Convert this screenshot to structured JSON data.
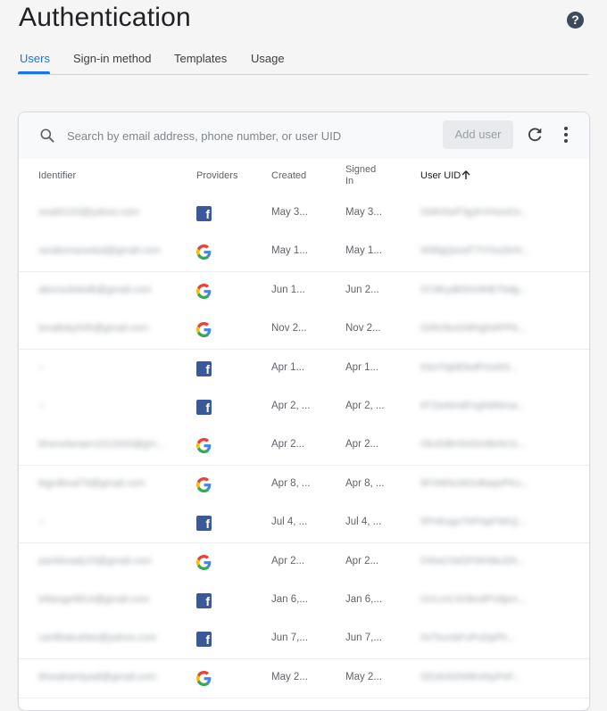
{
  "page": {
    "title": "Authentication",
    "help_icon": "help-circle-icon"
  },
  "tabs": [
    {
      "label": "Users",
      "active": true
    },
    {
      "label": "Sign-in method",
      "active": false
    },
    {
      "label": "Templates",
      "active": false
    },
    {
      "label": "Usage",
      "active": false
    }
  ],
  "toolbar": {
    "search_placeholder": "Search by email address, phone number, or user UID",
    "search_value": "",
    "add_user_label": "Add user",
    "refresh_icon": "refresh-icon",
    "more_icon": "more-vert-icon"
  },
  "table": {
    "columns": {
      "identifier": "Identifier",
      "providers": "Providers",
      "created": "Created",
      "signed_in_line1": "Signed",
      "signed_in_line2": "In",
      "user_uid": "User UID"
    },
    "sort_icon": "arrow-up-icon",
    "rows": [
      {
        "identifier": "ovati0153@yahoo.com",
        "provider": "facebook",
        "created": "May 3...",
        "signed_in": "May 3...",
        "uid": "GMHSeP3g3rVHsmDv..."
      },
      {
        "identifier": "raraitumaraskal@gmail.com",
        "provider": "google",
        "created": "May 1...",
        "signed_in": "May 1...",
        "uid": "W9tlgQevdT7tYhoZkHt..."
      },
      {
        "identifier": "abonsololedb@gmail.com",
        "provider": "google",
        "created": "Jun 1...",
        "signed_in": "Jun 2...",
        "uid": "O7dKydk5Hv9hB7Ndg..."
      },
      {
        "identifier": "lonaltoky545@gmail.com",
        "provider": "google",
        "created": "Nov 2...",
        "signed_in": "Nov 2...",
        "uid": "G0hOkoGMHgNAPPb..."
      },
      {
        "identifier": "--",
        "provider": "facebook",
        "created": "Apr 1...",
        "signed_in": "Apr 1...",
        "uid": "KkoYlqMDkdPmoK6..."
      },
      {
        "identifier": "--",
        "provider": "facebook",
        "created": "Apr 2, ...",
        "signed_in": "Apr 2, ...",
        "uid": "6TZwNmdFzghMNroa..."
      },
      {
        "identifier": "bhonulwraen1012000@gm...",
        "provider": "google",
        "created": "Apr 2...",
        "signed_in": "Apr 2...",
        "uid": "OkJGBHS0GmBsNr1t..."
      },
      {
        "identifier": "bignillmal79@gmail.com",
        "provider": "google",
        "created": "Apr 8, ...",
        "signed_in": "Apr 8, ...",
        "uid": "9F0WNcMGvBaqoPKs..."
      },
      {
        "identifier": "--",
        "provider": "facebook",
        "created": "Jul 4, ...",
        "signed_in": "Jul 4, ...",
        "uid": "5PHKsgv7hFHpFNKQ..."
      },
      {
        "identifier": "pambivady15@gmail.com",
        "provider": "google",
        "created": "Apr 2...",
        "signed_in": "Apr 2...",
        "uid": "D4IwUVeDFNhNkuDh..."
      },
      {
        "identifier": "loltange9814@gmail.com",
        "provider": "facebook",
        "created": "Jan 6,...",
        "signed_in": "Jan 6,...",
        "uid": "GVLmCSOkndPVdpm..."
      },
      {
        "identifier": "canfibalcahke@yahoo.com",
        "provider": "facebook",
        "created": "Jun 7,...",
        "signed_in": "Jun 7,...",
        "uid": "0VTsuVaFuPuDpPh..."
      },
      {
        "identifier": "ttheaikamtyadl@gmail.com",
        "provider": "google",
        "created": "May 2...",
        "signed_in": "May 2...",
        "uid": "GDzkSt2N9KsNyPoF..."
      }
    ]
  },
  "colors": {
    "accent": "#1a73e8",
    "facebook": "#3b5998",
    "background": "#f5f5f5"
  }
}
